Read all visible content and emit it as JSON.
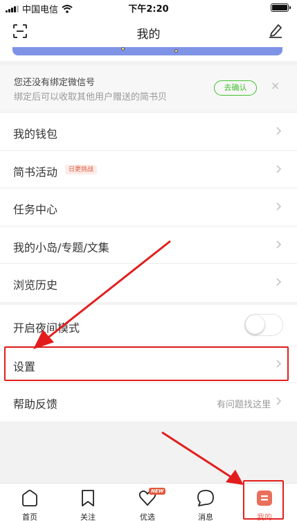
{
  "status": {
    "carrier": "中国电信",
    "time": "下午2:20"
  },
  "header": {
    "title": "我的"
  },
  "wechat_bind": {
    "line1": "您还没有绑定微信号",
    "line2": "绑定后可以收取其他用户赠送的简书贝",
    "confirm_label": "去确认",
    "close_label": "×"
  },
  "menu_group1": [
    {
      "label": "我的钱包"
    },
    {
      "label": "简书活动",
      "badge": "日更挑战"
    },
    {
      "label": "任务中心"
    },
    {
      "label": "我的小岛/专题/文集"
    },
    {
      "label": "浏览历史"
    }
  ],
  "menu_group2": {
    "night_mode": {
      "label": "开启夜间模式",
      "toggle_on": false
    },
    "settings": {
      "label": "设置"
    },
    "help": {
      "label": "帮助反馈",
      "hint": "有问题找这里"
    }
  },
  "tabs": [
    {
      "label": "首页",
      "icon": "home-icon"
    },
    {
      "label": "关注",
      "icon": "bookmark-icon"
    },
    {
      "label": "优选",
      "icon": "heart-icon",
      "badge": "NEW"
    },
    {
      "label": "消息",
      "icon": "chat-bubble-icon"
    },
    {
      "label": "我的",
      "icon": "profile-icon",
      "active": true
    }
  ],
  "colors": {
    "accent_green": "#42c02e",
    "brand_red": "#ea6f5a",
    "annotation_red": "#e31d1d",
    "banner_blue": "#7f93e6"
  }
}
